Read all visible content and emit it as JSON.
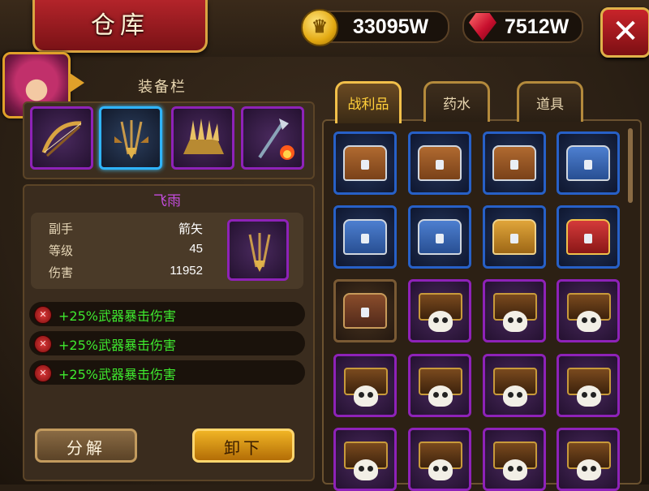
{
  "header": {
    "title": "仓库",
    "coins": "33095W",
    "gems": "7512W",
    "close_label": "✕"
  },
  "equip": {
    "title": "装备栏",
    "slots": [
      "crossbow",
      "arrow-bundle",
      "spiked-quiver",
      "fire-arrow"
    ],
    "selected": 1
  },
  "item": {
    "name": "飞雨",
    "stats": [
      {
        "label": "副手",
        "value": "箭矢"
      },
      {
        "label": "等级",
        "value": "45"
      },
      {
        "label": "伤害",
        "value": "11952"
      }
    ],
    "attributes": [
      "+25%武器暴击伤害",
      "+25%武器暴击伤害",
      "+25%武器暴击伤害"
    ]
  },
  "actions": {
    "split": "分解",
    "unequip": "卸下"
  },
  "tabs": [
    {
      "label": "战利品",
      "active": true
    },
    {
      "label": "药水",
      "active": false
    },
    {
      "label": "道具",
      "active": false
    }
  ],
  "inventory": [
    [
      "chest-brown-blue",
      "chest-brown-blue",
      "chest-brown-blue",
      "chest-blue"
    ],
    [
      "chest-blue",
      "chest-blue",
      "chest-gold",
      "chest-red"
    ],
    [
      "chest-wood",
      "skull-treasure",
      "skull-treasure",
      "skull-treasure"
    ],
    [
      "skull-treasure",
      "skull-treasure",
      "skull-treasure",
      "skull-treasure"
    ],
    [
      "skull-treasure",
      "skull-treasure",
      "skull-treasure",
      "skull-treasure"
    ]
  ],
  "colors": {
    "rarity_blue": "#2760c7",
    "rarity_purple": "#8e22b8",
    "attribute_green": "#3ee82e",
    "item_name_purple": "#c54ddf",
    "active_tab": "#ffce3a"
  }
}
